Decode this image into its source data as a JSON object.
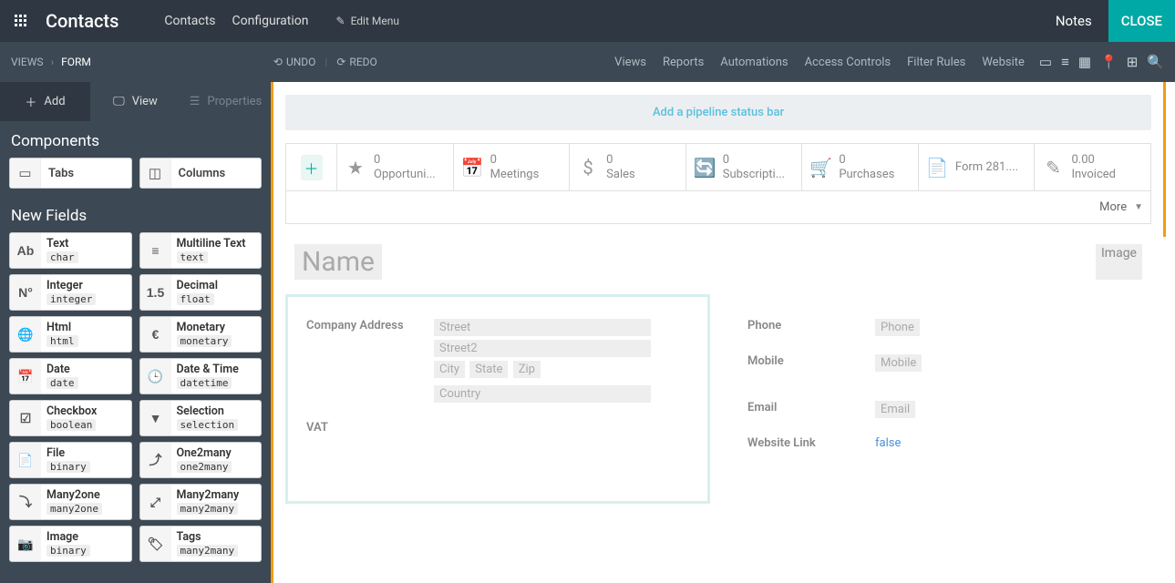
{
  "topbar": {
    "app_title": "Contacts",
    "nav": {
      "contacts": "Contacts",
      "configuration": "Configuration"
    },
    "edit_menu": "Edit Menu",
    "notes": "Notes",
    "close": "CLOSE"
  },
  "secondbar": {
    "breadcrumb": {
      "views": "VIEWS",
      "form": "FORM"
    },
    "undo": "UNDO",
    "redo": "REDO",
    "nav": {
      "views": "Views",
      "reports": "Reports",
      "automations": "Automations",
      "access": "Access Controls",
      "filter": "Filter Rules",
      "website": "Website"
    }
  },
  "sidebar": {
    "tabs": {
      "add": "Add",
      "view": "View",
      "properties": "Properties"
    },
    "components_title": "Components",
    "components": {
      "tabs": "Tabs",
      "columns": "Columns"
    },
    "newfields_title": "New Fields",
    "fields": [
      {
        "name": "Text",
        "type": "char",
        "icon": "Ab"
      },
      {
        "name": "Multiline Text",
        "type": "text",
        "icon": "≡"
      },
      {
        "name": "Integer",
        "type": "integer",
        "icon": "N°"
      },
      {
        "name": "Decimal",
        "type": "float",
        "icon": "1.5"
      },
      {
        "name": "Html",
        "type": "html",
        "icon": "🌐"
      },
      {
        "name": "Monetary",
        "type": "monetary",
        "icon": "€"
      },
      {
        "name": "Date",
        "type": "date",
        "icon": "📅"
      },
      {
        "name": "Date & Time",
        "type": "datetime",
        "icon": "🕒"
      },
      {
        "name": "Checkbox",
        "type": "boolean",
        "icon": "☑"
      },
      {
        "name": "Selection",
        "type": "selection",
        "icon": "▼"
      },
      {
        "name": "File",
        "type": "binary",
        "icon": "📄"
      },
      {
        "name": "One2many",
        "type": "one2many",
        "icon": "⤴"
      },
      {
        "name": "Many2one",
        "type": "many2one",
        "icon": "⤵"
      },
      {
        "name": "Many2many",
        "type": "many2many",
        "icon": "⤢"
      },
      {
        "name": "Image",
        "type": "binary",
        "icon": "📷"
      },
      {
        "name": "Tags",
        "type": "many2many",
        "icon": "🏷"
      }
    ]
  },
  "canvas": {
    "pipeline_text": "Add a pipeline status bar",
    "stats": [
      {
        "num": "0",
        "label": "Opportuni...",
        "icon": "★"
      },
      {
        "num": "0",
        "label": "Meetings",
        "icon": "📅"
      },
      {
        "num": "0",
        "label": "Sales",
        "icon": "$"
      },
      {
        "num": "0",
        "label": "Subscripti...",
        "icon": "🔄"
      },
      {
        "num": "0",
        "label": "Purchases",
        "icon": "🛒"
      },
      {
        "num": "",
        "label": "Form 281....",
        "icon": "📄"
      },
      {
        "num": "0.00",
        "label": "Invoiced",
        "icon": "✎"
      }
    ],
    "more": "More",
    "name_placeholder": "Name",
    "image_placeholder": "Image",
    "left": {
      "company_address": "Company Address",
      "street": "Street",
      "street2": "Street2",
      "city": "City",
      "state": "State",
      "zip": "Zip",
      "country": "Country",
      "vat": "VAT"
    },
    "right": {
      "phone": "Phone",
      "phone_ph": "Phone",
      "mobile": "Mobile",
      "mobile_ph": "Mobile",
      "email": "Email",
      "email_ph": "Email",
      "website": "Website Link",
      "website_val": "false"
    }
  }
}
